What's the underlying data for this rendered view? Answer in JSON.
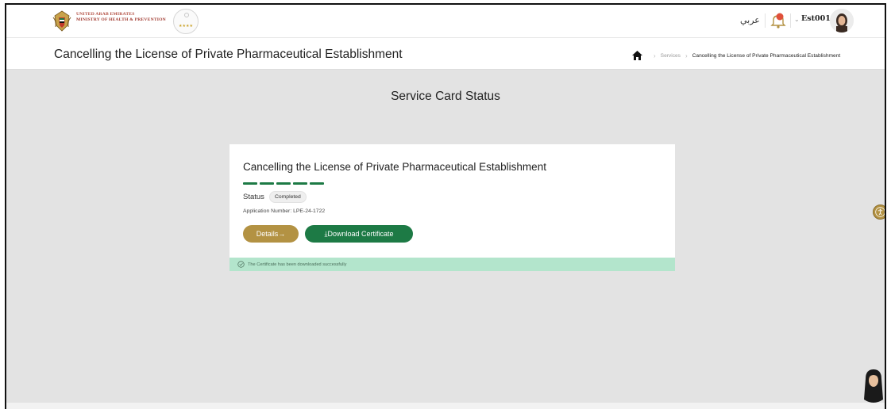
{
  "header": {
    "ministry_line1": "UNITED ARAB EMIRATES",
    "ministry_line2": "MINISTRY OF HEALTH & PREVENTION",
    "stars_badge": "★★★★",
    "language_toggle": "عربي",
    "username": "Est001",
    "icons": [
      "uae-emblem-icon",
      "star-rating-badge",
      "notification-bell-icon",
      "chevron-down-icon",
      "user-avatar"
    ]
  },
  "titlebar": {
    "page_title": "Cancelling the License of Private Pharmaceutical Establishment",
    "breadcrumb": {
      "home_icon": "home-icon",
      "services": "Services",
      "current": "Cancelling the License of Private Pharmaceutical Establishment"
    }
  },
  "main": {
    "section_title": "Service Card Status",
    "card": {
      "title": "Cancelling the License of Private Pharmaceutical Establishment",
      "progress_steps_completed": 5,
      "progress_steps_total": 5,
      "status_label": "Status",
      "status_value": "Completed",
      "application_number": "Application Number: LPE-24-1722",
      "details_button": "Details→",
      "download_button": "⤓Download Certificate",
      "success_message": "The Certificate has been downloaded successfully"
    }
  },
  "colors": {
    "gold": "#b39243",
    "green": "#1d7a45",
    "success_bg": "#b3e5cc",
    "page_bg": "#e3e3e3"
  }
}
